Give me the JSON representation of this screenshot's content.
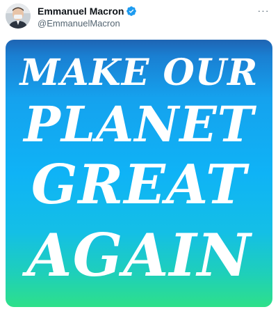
{
  "author": {
    "display_name": "Emmanuel Macron",
    "handle": "@EmmanuelMacron",
    "verified": true,
    "avatar_icon": "profile-photo",
    "verified_icon": "verified-badge-icon"
  },
  "actions": {
    "more_label": "···"
  },
  "media": {
    "lines": [
      "MAKE OUR",
      "PLANET",
      "GREAT",
      "AGAIN"
    ],
    "gradient_colors": [
      "#1f64b2",
      "#15a2ee",
      "#0fb3f6",
      "#1fd0b8",
      "#2ee08a"
    ],
    "text_color": "#ffffff"
  },
  "colors": {
    "verified_blue": "#1d9bf0",
    "name_text": "#0f1419",
    "handle_text": "#536471"
  }
}
